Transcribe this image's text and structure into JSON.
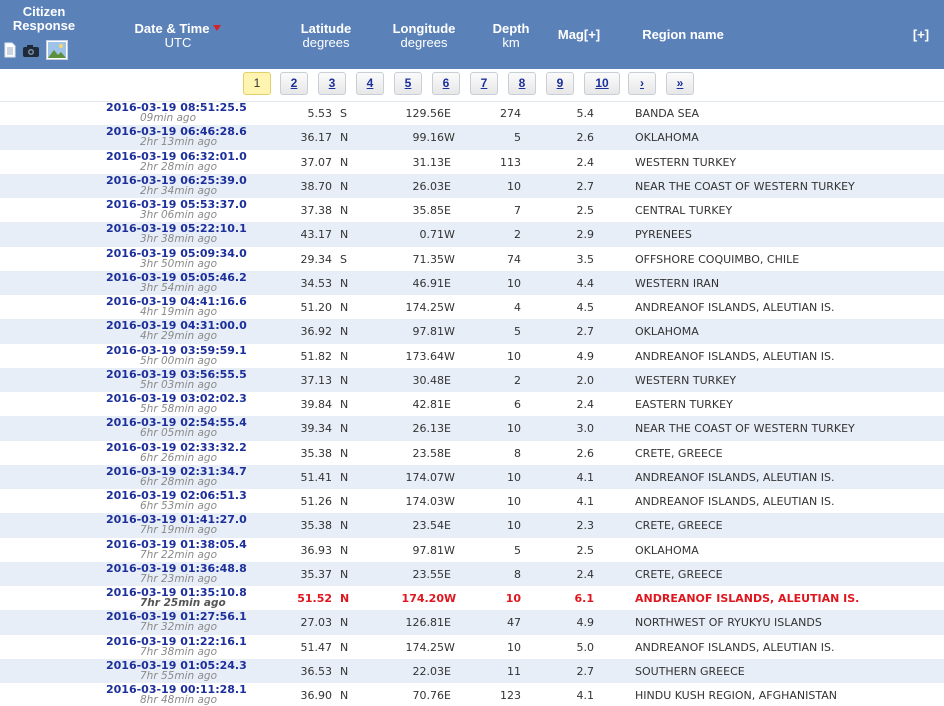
{
  "header": {
    "citizen_line1": "Citizen",
    "citizen_line2": "Response",
    "datetime_title": "Date & Time",
    "datetime_sub": "UTC",
    "lat_title": "Latitude",
    "lat_sub": "degrees",
    "lon_title": "Longitude",
    "lon_sub": "degrees",
    "depth_title": "Depth",
    "depth_sub": "km",
    "mag_title": "Mag[+]",
    "region_title": "Region name",
    "expand": "[+]",
    "colors": {
      "header_bg": "#5b82b8",
      "sort_arrow": "#d8202a"
    },
    "icons": [
      "document-icon",
      "camera-icon",
      "picture-icon",
      "sort-desc-arrow-icon"
    ]
  },
  "pagination": {
    "pages": [
      "1",
      "2",
      "3",
      "4",
      "5",
      "6",
      "7",
      "8",
      "9",
      "10",
      "›",
      "»"
    ],
    "active": "1"
  },
  "events": [
    {
      "dt": "2016-03-19   08:51:25.5",
      "ago": "09min ago",
      "lat": "5.53",
      "ns": "S",
      "lon": "129.56",
      "ew": "E",
      "depth": "274",
      "mag": "5.4",
      "region": "BANDA SEA"
    },
    {
      "dt": "2016-03-19   06:46:28.6",
      "ago": "2hr 13min ago",
      "lat": "36.17",
      "ns": "N",
      "lon": "99.16",
      "ew": "W",
      "depth": "5",
      "mag": "2.6",
      "region": "OKLAHOMA"
    },
    {
      "dt": "2016-03-19   06:32:01.0",
      "ago": "2hr 28min ago",
      "lat": "37.07",
      "ns": "N",
      "lon": "31.13",
      "ew": "E",
      "depth": "113",
      "mag": "2.4",
      "region": "WESTERN TURKEY"
    },
    {
      "dt": "2016-03-19   06:25:39.0",
      "ago": "2hr 34min ago",
      "lat": "38.70",
      "ns": "N",
      "lon": "26.03",
      "ew": "E",
      "depth": "10",
      "mag": "2.7",
      "region": "NEAR THE COAST OF WESTERN TURKEY"
    },
    {
      "dt": "2016-03-19   05:53:37.0",
      "ago": "3hr 06min ago",
      "lat": "37.38",
      "ns": "N",
      "lon": "35.85",
      "ew": "E",
      "depth": "7",
      "mag": "2.5",
      "region": "CENTRAL TURKEY"
    },
    {
      "dt": "2016-03-19   05:22:10.1",
      "ago": "3hr 38min ago",
      "lat": "43.17",
      "ns": "N",
      "lon": "0.71",
      "ew": "W",
      "depth": "2",
      "mag": "2.9",
      "region": "PYRENEES"
    },
    {
      "dt": "2016-03-19   05:09:34.0",
      "ago": "3hr 50min ago",
      "lat": "29.34",
      "ns": "S",
      "lon": "71.35",
      "ew": "W",
      "depth": "74",
      "mag": "3.5",
      "region": "OFFSHORE COQUIMBO, CHILE"
    },
    {
      "dt": "2016-03-19   05:05:46.2",
      "ago": "3hr 54min ago",
      "lat": "34.53",
      "ns": "N",
      "lon": "46.91",
      "ew": "E",
      "depth": "10",
      "mag": "4.4",
      "region": "WESTERN IRAN"
    },
    {
      "dt": "2016-03-19   04:41:16.6",
      "ago": "4hr 19min ago",
      "lat": "51.20",
      "ns": "N",
      "lon": "174.25",
      "ew": "W",
      "depth": "4",
      "mag": "4.5",
      "region": "ANDREANOF ISLANDS, ALEUTIAN IS."
    },
    {
      "dt": "2016-03-19   04:31:00.0",
      "ago": "4hr 29min ago",
      "lat": "36.92",
      "ns": "N",
      "lon": "97.81",
      "ew": "W",
      "depth": "5",
      "mag": "2.7",
      "region": "OKLAHOMA"
    },
    {
      "dt": "2016-03-19   03:59:59.1",
      "ago": "5hr 00min ago",
      "lat": "51.82",
      "ns": "N",
      "lon": "173.64",
      "ew": "W",
      "depth": "10",
      "mag": "4.9",
      "region": "ANDREANOF ISLANDS, ALEUTIAN IS."
    },
    {
      "dt": "2016-03-19   03:56:55.5",
      "ago": "5hr 03min ago",
      "lat": "37.13",
      "ns": "N",
      "lon": "30.48",
      "ew": "E",
      "depth": "2",
      "mag": "2.0",
      "region": "WESTERN TURKEY"
    },
    {
      "dt": "2016-03-19   03:02:02.3",
      "ago": "5hr 58min ago",
      "lat": "39.84",
      "ns": "N",
      "lon": "42.81",
      "ew": "E",
      "depth": "6",
      "mag": "2.4",
      "region": "EASTERN TURKEY"
    },
    {
      "dt": "2016-03-19   02:54:55.4",
      "ago": "6hr 05min ago",
      "lat": "39.34",
      "ns": "N",
      "lon": "26.13",
      "ew": "E",
      "depth": "10",
      "mag": "3.0",
      "region": "NEAR THE COAST OF WESTERN TURKEY"
    },
    {
      "dt": "2016-03-19   02:33:32.2",
      "ago": "6hr 26min ago",
      "lat": "35.38",
      "ns": "N",
      "lon": "23.58",
      "ew": "E",
      "depth": "8",
      "mag": "2.6",
      "region": "CRETE, GREECE"
    },
    {
      "dt": "2016-03-19   02:31:34.7",
      "ago": "6hr 28min ago",
      "lat": "51.41",
      "ns": "N",
      "lon": "174.07",
      "ew": "W",
      "depth": "10",
      "mag": "4.1",
      "region": "ANDREANOF ISLANDS, ALEUTIAN IS."
    },
    {
      "dt": "2016-03-19   02:06:51.3",
      "ago": "6hr 53min ago",
      "lat": "51.26",
      "ns": "N",
      "lon": "174.03",
      "ew": "W",
      "depth": "10",
      "mag": "4.1",
      "region": "ANDREANOF ISLANDS, ALEUTIAN IS."
    },
    {
      "dt": "2016-03-19   01:41:27.0",
      "ago": "7hr 19min ago",
      "lat": "35.38",
      "ns": "N",
      "lon": "23.54",
      "ew": "E",
      "depth": "10",
      "mag": "2.3",
      "region": "CRETE, GREECE"
    },
    {
      "dt": "2016-03-19   01:38:05.4",
      "ago": "7hr 22min ago",
      "lat": "36.93",
      "ns": "N",
      "lon": "97.81",
      "ew": "W",
      "depth": "5",
      "mag": "2.5",
      "region": "OKLAHOMA"
    },
    {
      "dt": "2016-03-19   01:36:48.8",
      "ago": "7hr 23min ago",
      "lat": "35.37",
      "ns": "N",
      "lon": "23.55",
      "ew": "E",
      "depth": "8",
      "mag": "2.4",
      "region": "CRETE, GREECE"
    },
    {
      "dt": "2016-03-19   01:35:10.8",
      "ago": "7hr 25min ago",
      "lat": "51.52",
      "ns": "N",
      "lon": "174.20",
      "ew": "W",
      "depth": "10",
      "mag": "6.1",
      "region": "ANDREANOF ISLANDS, ALEUTIAN IS.",
      "highlight": true
    },
    {
      "dt": "2016-03-19   01:27:56.1",
      "ago": "7hr 32min ago",
      "lat": "27.03",
      "ns": "N",
      "lon": "126.81",
      "ew": "E",
      "depth": "47",
      "mag": "4.9",
      "region": "NORTHWEST OF RYUKYU ISLANDS"
    },
    {
      "dt": "2016-03-19   01:22:16.1",
      "ago": "7hr 38min ago",
      "lat": "51.47",
      "ns": "N",
      "lon": "174.25",
      "ew": "W",
      "depth": "10",
      "mag": "5.0",
      "region": "ANDREANOF ISLANDS, ALEUTIAN IS."
    },
    {
      "dt": "2016-03-19   01:05:24.3",
      "ago": "7hr 55min ago",
      "lat": "36.53",
      "ns": "N",
      "lon": "22.03",
      "ew": "E",
      "depth": "11",
      "mag": "2.7",
      "region": "SOUTHERN GREECE"
    },
    {
      "dt": "2016-03-19   00:11:28.1",
      "ago": "8hr 48min ago",
      "lat": "36.90",
      "ns": "N",
      "lon": "70.76",
      "ew": "E",
      "depth": "123",
      "mag": "4.1",
      "region": "HINDU KUSH REGION, AFGHANISTAN"
    }
  ]
}
